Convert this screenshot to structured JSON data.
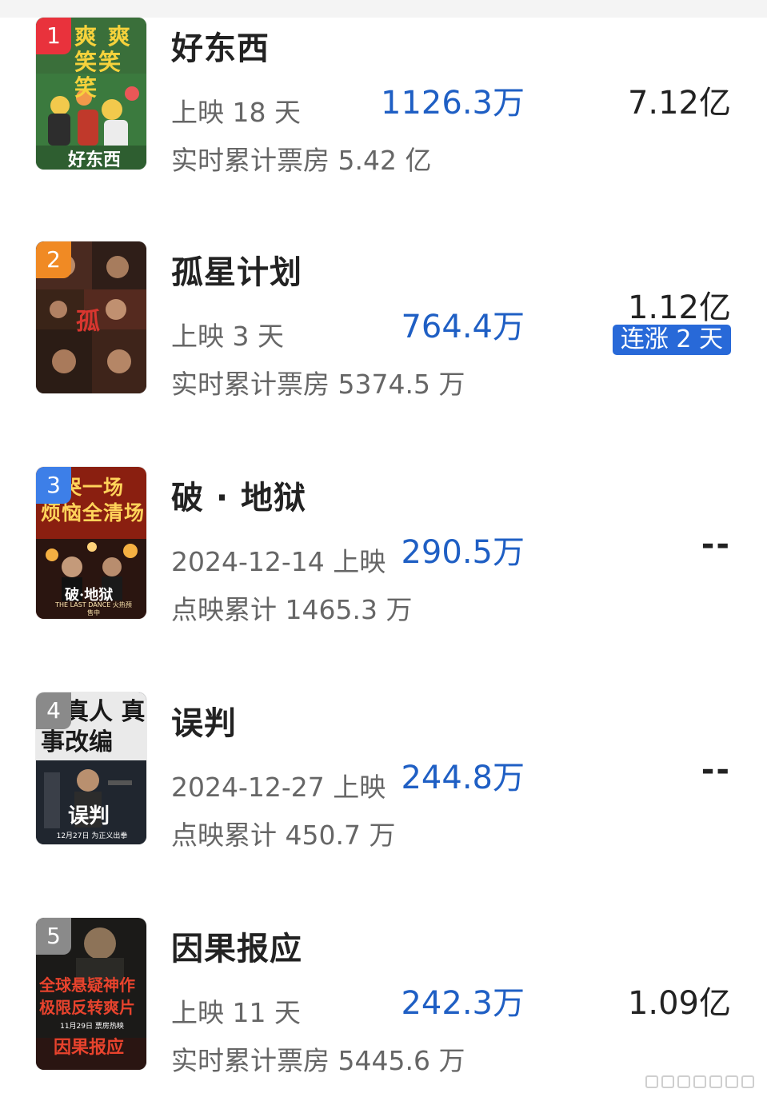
{
  "colors": {
    "accent": "#1f5fc4",
    "tag_bg": "#2869d8",
    "rank1": "#e9323c",
    "rank2": "#f08a24",
    "rank3": "#3d7fe8",
    "rank4": "#8a8a8a",
    "rank5": "#8a8a8a"
  },
  "movies": [
    {
      "rank": "1",
      "title": "好东西",
      "line1": "上映 18 天",
      "line2": "实时累计票房 5.42 亿",
      "daily": "1126.3万",
      "total": "7.12亿",
      "tag": "",
      "poster_text": "爽 爽 笑笑笑",
      "poster_title": "好东西"
    },
    {
      "rank": "2",
      "title": "孤星计划",
      "line1": "上映 3 天",
      "line2": "实时累计票房 5374.5 万",
      "daily": "764.4万",
      "total": "1.12亿",
      "tag": "连涨 2 天",
      "poster_text": "",
      "poster_title": ""
    },
    {
      "rank": "3",
      "title": "破 · 地狱",
      "line1": "2024-12-14 上映",
      "line2": "点映累计 1465.3 万",
      "daily": "290.5万",
      "total": "--",
      "tag": "",
      "poster_text": "大哭一场 烦恼全清场",
      "poster_title": "破·地狱",
      "poster_sub": "THE LAST DANCE 火热预售中"
    },
    {
      "rank": "4",
      "title": "误判",
      "line1": "2024-12-27 上映",
      "line2": "点映累计 450.7 万",
      "daily": "244.8万",
      "total": "--",
      "tag": "",
      "poster_text": "据真人 真事改编",
      "poster_title": "误判",
      "poster_sub": "12月27日 为正义出拳"
    },
    {
      "rank": "5",
      "title": "因果报应",
      "line1": "上映 11 天",
      "line2": "实时累计票房 5445.6 万",
      "daily": "242.3万",
      "total": "1.09亿",
      "tag": "",
      "poster_text": "全球悬疑神作 极限反转爽片",
      "poster_title": "因果报应",
      "poster_sub": "11月29日 票房热映"
    }
  ]
}
